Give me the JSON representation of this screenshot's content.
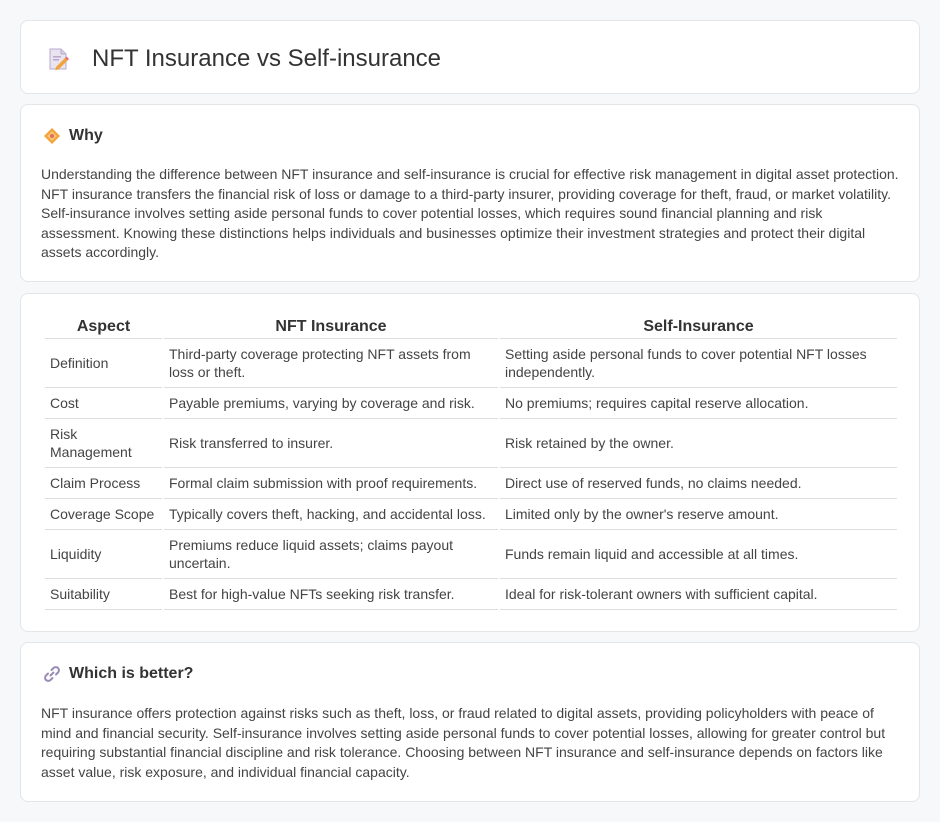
{
  "header": {
    "title": "NFT Insurance vs Self-insurance",
    "icon": "document-pencil-icon"
  },
  "why": {
    "title": "Why",
    "icon": "diamond-icon",
    "text": "Understanding the difference between NFT insurance and self-insurance is crucial for effective risk management in digital asset protection. NFT insurance transfers the financial risk of loss or damage to a third-party insurer, providing coverage for theft, fraud, or market volatility. Self-insurance involves setting aside personal funds to cover potential losses, which requires sound financial planning and risk assessment. Knowing these distinctions helps individuals and businesses optimize their investment strategies and protect their digital assets accordingly."
  },
  "table": {
    "headers": [
      "Aspect",
      "NFT Insurance",
      "Self-Insurance"
    ],
    "rows": [
      {
        "aspect": "Definition",
        "nft": "Third-party coverage protecting NFT assets from loss or theft.",
        "self": "Setting aside personal funds to cover potential NFT losses independently."
      },
      {
        "aspect": "Cost",
        "nft": "Payable premiums, varying by coverage and risk.",
        "self": "No premiums; requires capital reserve allocation."
      },
      {
        "aspect": "Risk Management",
        "nft": "Risk transferred to insurer.",
        "self": "Risk retained by the owner."
      },
      {
        "aspect": "Claim Process",
        "nft": "Formal claim submission with proof requirements.",
        "self": "Direct use of reserved funds, no claims needed."
      },
      {
        "aspect": "Coverage Scope",
        "nft": "Typically covers theft, hacking, and accidental loss.",
        "self": "Limited only by the owner's reserve amount."
      },
      {
        "aspect": "Liquidity",
        "nft": "Premiums reduce liquid assets; claims payout uncertain.",
        "self": "Funds remain liquid and accessible at all times."
      },
      {
        "aspect": "Suitability",
        "nft": "Best for high-value NFTs seeking risk transfer.",
        "self": "Ideal for risk-tolerant owners with sufficient capital."
      }
    ]
  },
  "better": {
    "title": "Which is better?",
    "icon": "link-icon",
    "text": "NFT insurance offers protection against risks such as theft, loss, or fraud related to digital assets, providing policyholders with peace of mind and financial security. Self-insurance involves setting aside personal funds to cover potential losses, allowing for greater control but requiring substantial financial discipline and risk tolerance. Choosing between NFT insurance and self-insurance depends on factors like asset value, risk exposure, and individual financial capacity."
  },
  "colors": {
    "background": "#f7f8fa",
    "card": "#ffffff",
    "border": "#e3e5e8",
    "accent_orange": "#f0a43a",
    "accent_pink": "#e96a6a"
  }
}
